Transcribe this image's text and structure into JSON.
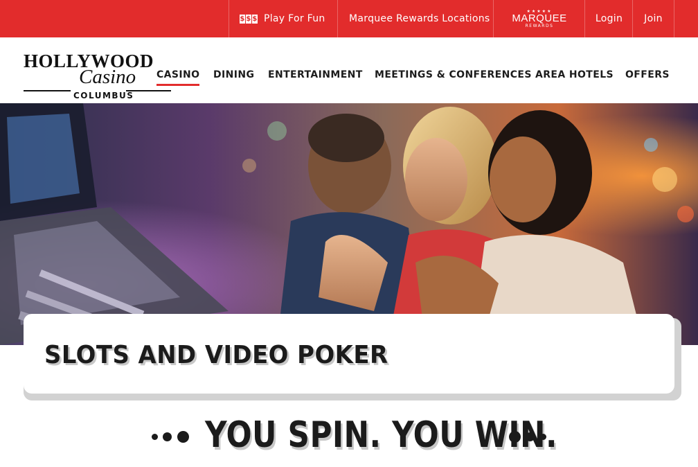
{
  "topbar": {
    "play_label": "Play For Fun",
    "play_icon": "$$$",
    "locations_label": "Marquee Rewards Locations",
    "marquee_stars": "★★★★★",
    "marquee_word": "MARQUEE",
    "marquee_sub": "REWARDS",
    "login_label": "Login",
    "join_label": "Join",
    "bg_color": "#e22c2c"
  },
  "logo": {
    "hollywood": "HOLLYWOOD",
    "casino": "Casino",
    "columbus": "COLUMBUS"
  },
  "nav": {
    "items": [
      {
        "label": "CASINO",
        "active": true
      },
      {
        "label": "DINING"
      },
      {
        "label": "ENTERTAINMENT"
      },
      {
        "label": "MEETINGS & CONFERENCES"
      },
      {
        "label": "AREA HOTELS"
      },
      {
        "label": "OFFERS"
      }
    ],
    "active_color": "#e22c2c"
  },
  "page": {
    "title": "SLOTS AND VIDEO POKER",
    "tagline": "YOU SPIN. YOU WIN."
  }
}
